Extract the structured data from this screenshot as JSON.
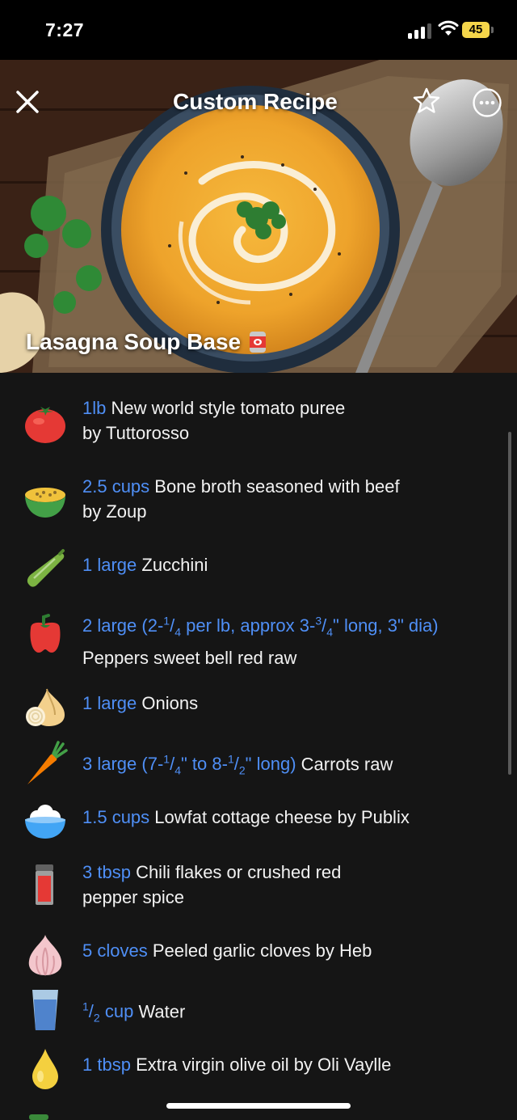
{
  "status": {
    "time": "7:27",
    "battery": "45"
  },
  "header": {
    "title": "Custom Recipe",
    "recipe_name": "Lasagna Soup Base"
  },
  "ingredients": [
    {
      "amount": "1lb",
      "name": "New world style tomato puree",
      "brand": "by Tuttorosso",
      "icon": "tomato-icon"
    },
    {
      "amount": "2.5 cups",
      "name": "Bone broth seasoned with beef",
      "brand": "by Zoup",
      "icon": "soup-bowl-icon"
    },
    {
      "amount": "1 large",
      "name": "Zucchini",
      "brand": "",
      "icon": "zucchini-icon"
    },
    {
      "amount_pre": "2 large (2-",
      "amount_frac1_num": "1",
      "amount_frac1_den": "4",
      "amount_mid": " per lb, approx 3-",
      "amount_frac2_num": "3",
      "amount_frac2_den": "4",
      "amount_post": "\" long, 3\" dia)",
      "name": "Peppers sweet bell red raw",
      "icon": "bell-pepper-icon"
    },
    {
      "amount": "1 large",
      "name": "Onions",
      "icon": "onion-icon"
    },
    {
      "amount_pre": "3 large (7-",
      "amount_frac1_num": "1",
      "amount_frac1_den": "4",
      "amount_mid": "\" to 8-",
      "amount_frac2_num": "1",
      "amount_frac2_den": "2",
      "amount_post": "\" long)",
      "name": "Carrots raw",
      "icon": "carrot-icon"
    },
    {
      "amount": "1.5 cups",
      "name": "Lowfat cottage cheese by Publix",
      "icon": "cottage-cheese-icon"
    },
    {
      "amount": "3 tbsp",
      "name": "Chili flakes or crushed red",
      "brand": "pepper spice",
      "icon": "spice-jar-icon"
    },
    {
      "amount": "5 cloves",
      "name": "Peeled garlic cloves by Heb",
      "icon": "garlic-icon"
    },
    {
      "amount_frac_num": "1",
      "amount_frac_den": "2",
      "amount": " cup",
      "name": "Water",
      "icon": "water-glass-icon"
    },
    {
      "amount": "1 tbsp",
      "name": "Extra virgin olive oil by Oli Vaylle",
      "icon": "oil-drop-icon"
    }
  ],
  "colors": {
    "accent": "#4f8ff6",
    "background": "#151515"
  }
}
